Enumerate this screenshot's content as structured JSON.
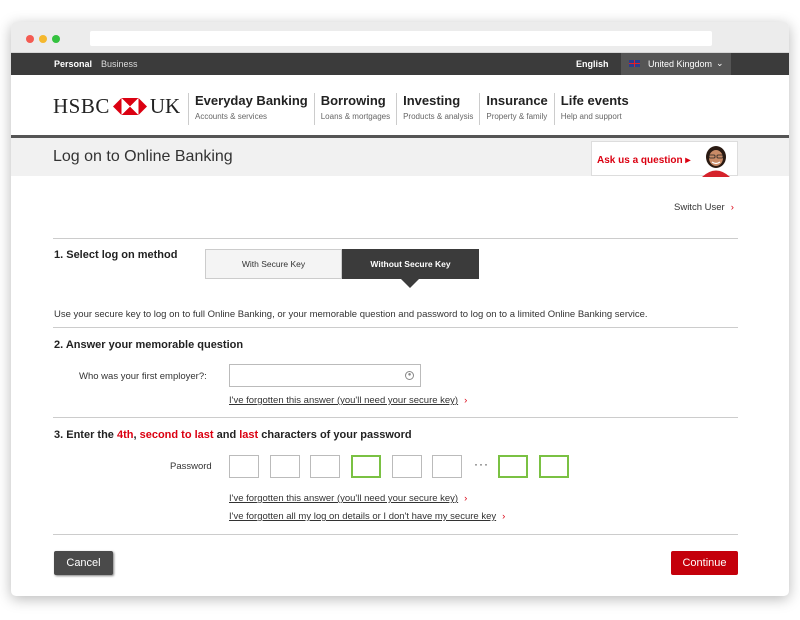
{
  "topnav": {
    "personal": "Personal",
    "business": "Business",
    "language": "English",
    "country": "United Kingdom"
  },
  "logo": {
    "text1": "HSBC",
    "text2": "UK"
  },
  "mainnav": [
    {
      "title": "Everyday Banking",
      "sub": "Accounts & services"
    },
    {
      "title": "Borrowing",
      "sub": "Loans & mortgages"
    },
    {
      "title": "Investing",
      "sub": "Products & analysis"
    },
    {
      "title": "Insurance",
      "sub": "Property & family"
    },
    {
      "title": "Life events",
      "sub": "Help and support"
    }
  ],
  "page": {
    "title": "Log on to Online Banking",
    "ask_label": "Ask us a question ▸",
    "switch_user": "Switch User"
  },
  "step1": {
    "heading": "1. Select log on method",
    "tab_with": "With Secure Key",
    "tab_without": "Without Secure Key",
    "info": "Use your secure key to log on to full Online Banking, or your memorable question and password to log on to a limited Online Banking service."
  },
  "step2": {
    "heading": "2. Answer your memorable question",
    "question": "Who was your first employer?:",
    "forgot": "I've forgotten this answer (you'll need your secure key)"
  },
  "step3": {
    "heading_pre": "3. Enter the ",
    "h_4th": "4th",
    "h_sep1": ", ",
    "h_second": "second to last",
    "h_and": " and ",
    "h_last": "last",
    "heading_post": " characters of your password",
    "password_label": "Password",
    "dots": "···",
    "forgot_answer": "I've forgotten this answer (you'll need your secure key)",
    "forgot_all": "I've forgotten all my log on details or I don't have my secure key"
  },
  "buttons": {
    "cancel": "Cancel",
    "continue": "Continue"
  },
  "colors": {
    "brand_red": "#db0011",
    "dark": "#3b3b3b",
    "highlight": "#7ac143"
  }
}
